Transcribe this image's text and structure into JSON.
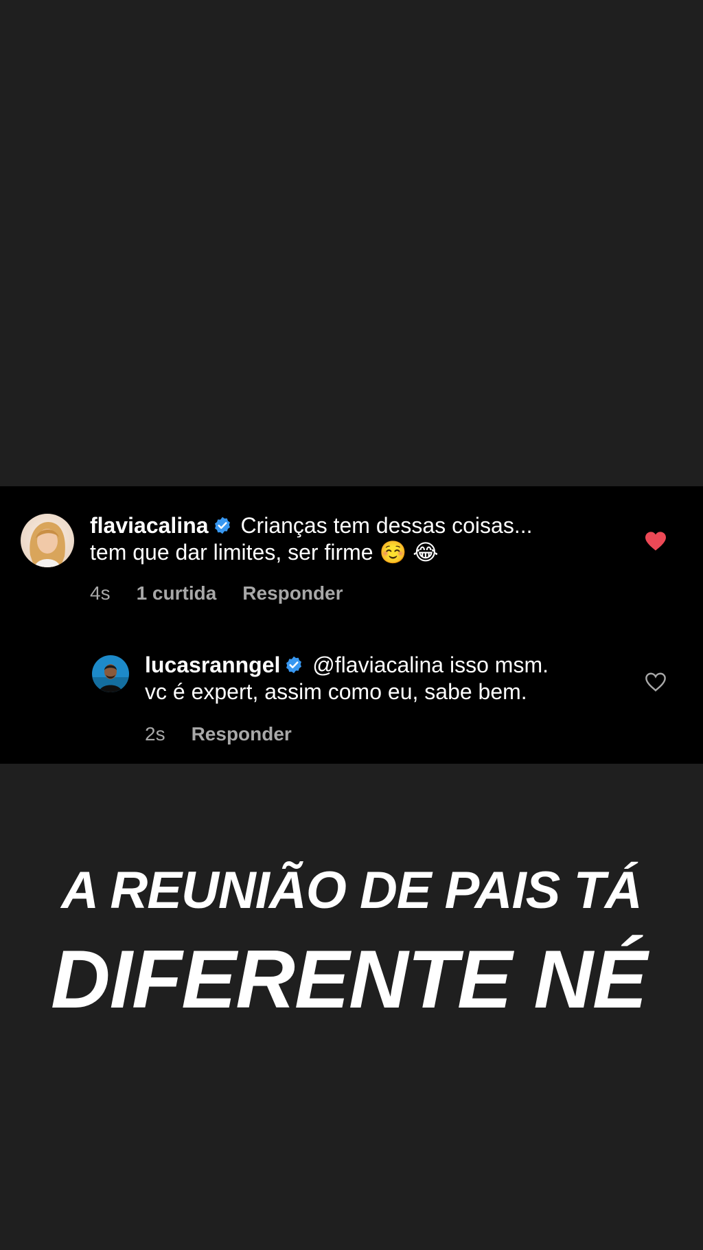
{
  "comments": [
    {
      "username": "flaviacalina",
      "text_line1": "Crianças tem dessas coisas...",
      "text_line2": "tem que dar limites, ser firme ☺️ 😂",
      "time": "4s",
      "likes": "1 curtida",
      "reply": "Responder",
      "liked": true
    },
    {
      "username": "lucasranngel",
      "text_line1": "@flaviacalina isso msm.",
      "text_line2": "vc é expert, assim como eu, sabe bem.",
      "time": "2s",
      "reply": "Responder",
      "liked": false
    }
  ],
  "caption": {
    "line1": "A REUNIÃO DE PAIS TÁ",
    "line2": "DIFERENTE NÉ"
  },
  "colors": {
    "background": "#1f1f1f",
    "card": "#000000",
    "verified": "#3897f0",
    "heart_liked": "#ed4956",
    "meta_text": "#a8a8a8"
  }
}
